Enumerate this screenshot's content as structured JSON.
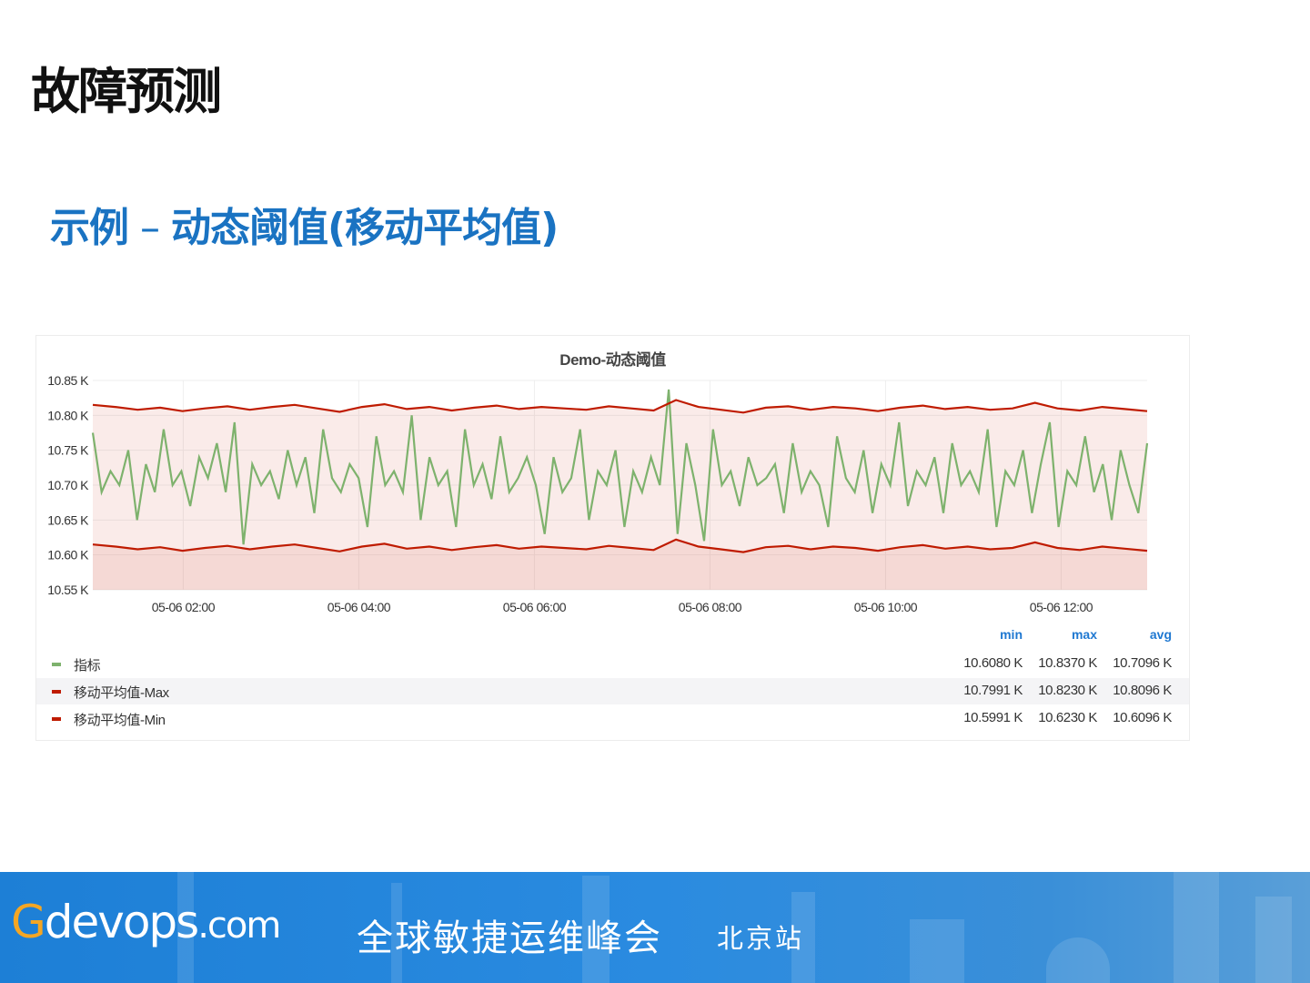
{
  "slide": {
    "title": "故障预测",
    "subtitle_prefix": "示例",
    "subtitle_dash": " – ",
    "subtitle_main": "动态阈值(移动平均值)"
  },
  "chart_data": {
    "type": "line",
    "title": "Demo-动态阈值",
    "xlabel": "",
    "ylabel": "",
    "ylim": [
      10.55,
      10.85
    ],
    "yticks": [
      "10.85 K",
      "10.80 K",
      "10.75 K",
      "10.70 K",
      "10.65 K",
      "10.60 K",
      "10.55 K"
    ],
    "ytick_values": [
      10.85,
      10.8,
      10.75,
      10.7,
      10.65,
      10.6,
      10.55
    ],
    "xrange_hours": [
      0.97,
      12.98
    ],
    "xticks": [
      "05-06 02:00",
      "05-06 04:00",
      "05-06 06:00",
      "05-06 08:00",
      "05-06 10:00",
      "05-06 12:00"
    ],
    "xtick_hours": [
      2,
      4,
      6,
      8,
      10,
      12
    ],
    "grid": true,
    "legend_placement": "bottom",
    "legend_columns": [
      "min",
      "max",
      "avg"
    ],
    "series": [
      {
        "name": "指标",
        "color": "#7eb26d",
        "stats": [
          "10.6080 K",
          "10.8370 K",
          "10.7096 K"
        ],
        "values": [
          10.775,
          10.69,
          10.72,
          10.7,
          10.75,
          10.65,
          10.73,
          10.69,
          10.78,
          10.7,
          10.72,
          10.67,
          10.74,
          10.71,
          10.76,
          10.69,
          10.79,
          10.615,
          10.73,
          10.7,
          10.72,
          10.68,
          10.75,
          10.7,
          10.74,
          10.66,
          10.78,
          10.71,
          10.69,
          10.73,
          10.71,
          10.64,
          10.77,
          10.7,
          10.72,
          10.69,
          10.8,
          10.65,
          10.74,
          10.7,
          10.72,
          10.64,
          10.78,
          10.7,
          10.73,
          10.68,
          10.77,
          10.69,
          10.71,
          10.74,
          10.7,
          10.63,
          10.74,
          10.69,
          10.71,
          10.78,
          10.65,
          10.72,
          10.7,
          10.75,
          10.64,
          10.72,
          10.69,
          10.74,
          10.7,
          10.837,
          10.63,
          10.76,
          10.7,
          10.62,
          10.78,
          10.7,
          10.72,
          10.67,
          10.74,
          10.7,
          10.71,
          10.73,
          10.66,
          10.76,
          10.69,
          10.72,
          10.7,
          10.64,
          10.77,
          10.71,
          10.69,
          10.75,
          10.66,
          10.73,
          10.7,
          10.79,
          10.67,
          10.72,
          10.7,
          10.74,
          10.66,
          10.76,
          10.7,
          10.72,
          10.69,
          10.78,
          10.64,
          10.72,
          10.7,
          10.75,
          10.66,
          10.73,
          10.79,
          10.64,
          10.72,
          10.7,
          10.77,
          10.69,
          10.73,
          10.65,
          10.75,
          10.7,
          10.66,
          10.76
        ]
      },
      {
        "name": "移动平均值-Max",
        "color": "#bf1b00",
        "stats": [
          "10.7991 K",
          "10.8230 K",
          "10.8096 K"
        ],
        "values": [
          10.815,
          10.812,
          10.808,
          10.811,
          10.806,
          10.81,
          10.813,
          10.808,
          10.812,
          10.815,
          10.81,
          10.805,
          10.812,
          10.816,
          10.809,
          10.812,
          10.807,
          10.811,
          10.814,
          10.809,
          10.812,
          10.81,
          10.808,
          10.813,
          10.81,
          10.807,
          10.822,
          10.812,
          10.808,
          10.804,
          10.811,
          10.813,
          10.808,
          10.812,
          10.81,
          10.806,
          10.811,
          10.814,
          10.809,
          10.812,
          10.808,
          10.81,
          10.818,
          10.81,
          10.807,
          10.812,
          10.809,
          10.806
        ]
      },
      {
        "name": "移动平均值-Min",
        "color": "#bf1b00",
        "stats": [
          "10.5991 K",
          "10.6230 K",
          "10.6096 K"
        ],
        "values": [
          10.615,
          10.612,
          10.608,
          10.611,
          10.606,
          10.61,
          10.613,
          10.608,
          10.612,
          10.615,
          10.61,
          10.605,
          10.612,
          10.616,
          10.609,
          10.612,
          10.607,
          10.611,
          10.614,
          10.609,
          10.612,
          10.61,
          10.608,
          10.613,
          10.61,
          10.607,
          10.622,
          10.612,
          10.608,
          10.604,
          10.611,
          10.613,
          10.608,
          10.612,
          10.61,
          10.606,
          10.611,
          10.614,
          10.609,
          10.612,
          10.608,
          10.61,
          10.618,
          10.61,
          10.607,
          10.612,
          10.609,
          10.606
        ]
      }
    ]
  },
  "footer": {
    "logo_g": "G",
    "logo_text": "devops",
    "logo_domain": ".com",
    "slogan": "全球敏捷运维峰会",
    "city": "北京站"
  }
}
